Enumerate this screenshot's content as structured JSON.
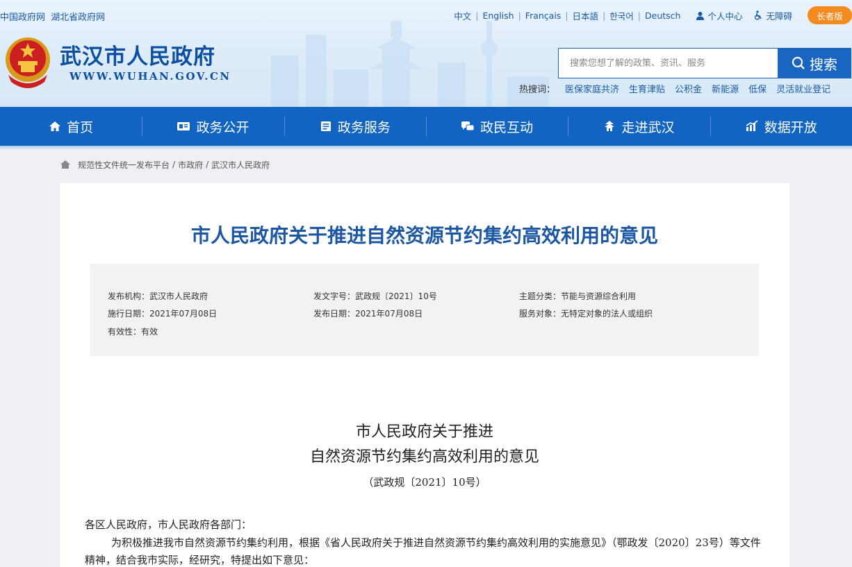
{
  "header": {
    "top_left_links": [
      "中国政府网",
      "湖北省政府网"
    ],
    "languages": [
      "中文",
      "English",
      "Français",
      "日本語",
      "한국어",
      "Deutsch"
    ],
    "personal_center": "个人中心",
    "accessibility": "无障碍",
    "elder_version": "长者版",
    "site_title": "武汉市人民政府",
    "site_url": "WWW.WUHAN.GOV.CN",
    "search_placeholder": "搜索您想了解的政策、资讯、服务",
    "search_button": "搜索",
    "hot_label": "热搜词：",
    "hot_words": [
      "医保家庭共济",
      "生育津贴",
      "公积金",
      "新能源",
      "低保",
      "灵活就业登记"
    ]
  },
  "nav": {
    "items": [
      {
        "label": "首页",
        "icon": "home-icon"
      },
      {
        "label": "政务公开",
        "icon": "id-card-icon"
      },
      {
        "label": "政务服务",
        "icon": "document-icon"
      },
      {
        "label": "政民互动",
        "icon": "chat-icon"
      },
      {
        "label": "走进武汉",
        "icon": "pavilion-icon"
      },
      {
        "label": "数据开放",
        "icon": "chart-icon"
      }
    ]
  },
  "breadcrumb": [
    "规范性文件统一发布平台",
    "市政府",
    "武汉市人民政府"
  ],
  "document": {
    "title": "市人民政府关于推进自然资源节约集约高效利用的意见",
    "meta": {
      "issuer_label": "发布机构：",
      "issuer": "武汉市人民政府",
      "doc_no_label": "发文字号：",
      "doc_no": "武政规〔2021〕10号",
      "topic_label": "主题分类：",
      "topic": "节能与资源综合利用",
      "effective_label": "施行日期：",
      "effective": "2021年07月08日",
      "publish_label": "发布日期：",
      "publish": "2021年07月08日",
      "target_label": "服务对象：",
      "target": "无特定对象的法人或组织",
      "validity_label": "有效性：",
      "validity": "有效"
    },
    "heading_line1": "市人民政府关于推进",
    "heading_line2": "自然资源节约集约高效利用的意见",
    "number": "（武政规〔2021〕10号）",
    "salutation": "各区人民政府，市人民政府各部门：",
    "paragraph1": "为积极推进我市自然资源节约集约利用，根据《省人民政府关于推进自然资源节约集约高效利用的实施意见》（鄂政发〔2020〕23号）等文件精神，结合我市实际，经研究，特提出如下意见："
  }
}
